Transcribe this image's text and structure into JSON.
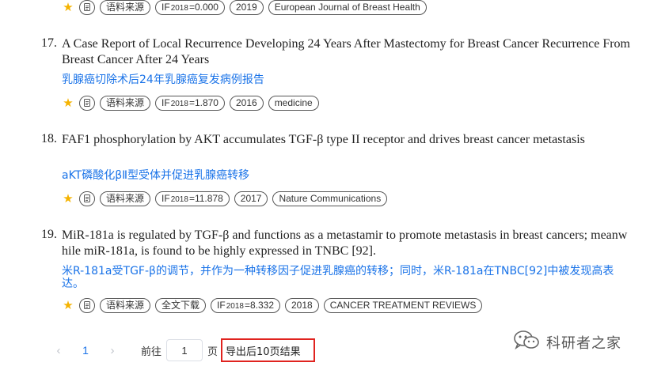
{
  "tag_icon": "copy-icon",
  "source_label": "语料来源",
  "fulltext_label": "全文下载",
  "if_prefix": "IF",
  "if_year": "2018",
  "items": [
    {
      "if_value": "=0.000",
      "year": "2019",
      "journal": "European Journal of Breast Health"
    },
    {
      "num": "17.",
      "title": "A Case Report of Local Recurrence Developing 24 Years After Mastectomy for Breast Cancer Recurrence From Breast Cancer After 24 Years",
      "translation": "乳腺癌切除术后24年乳腺癌复发病例报告",
      "if_value": "=1.870",
      "year": "2016",
      "journal": "medicine"
    },
    {
      "num": "18.",
      "title": "FAF1 phosphorylation by AKT accumulates TGF-β type II receptor and drives breast cancer metastasis",
      "translation": "aKT磷酸化βⅡ型受体并促进乳腺癌转移",
      "if_value": "=11.878",
      "year": "2017",
      "journal": "Nature Communications"
    },
    {
      "num": "19.",
      "title": "MiR-181a is regulated by TGF-β and functions as a metastamir to promote metastasis in breast cancers; meanwhile miR-181a, is found to be highly expressed in TNBC [92].",
      "translation": "米R-181a受TGF-β的调节，并作为一种转移因子促进乳腺癌的转移；同时，米R-181a在TNBC[92]中被发现高表达。",
      "if_value": "=8.332",
      "year": "2018",
      "journal": "CANCER TREATMENT REVIEWS"
    }
  ],
  "pager": {
    "prev": "‹",
    "current": "1",
    "next": "›",
    "goto_label": "前往",
    "page_value": "1",
    "page_unit": "页",
    "export_label": "导出后10页结果"
  },
  "watermark": {
    "text": "科研者之家",
    "icon": "wechat-icon"
  },
  "colors": {
    "accent": "#1a73e8",
    "star": "#f5b301",
    "highlight_border": "#e0231f"
  }
}
